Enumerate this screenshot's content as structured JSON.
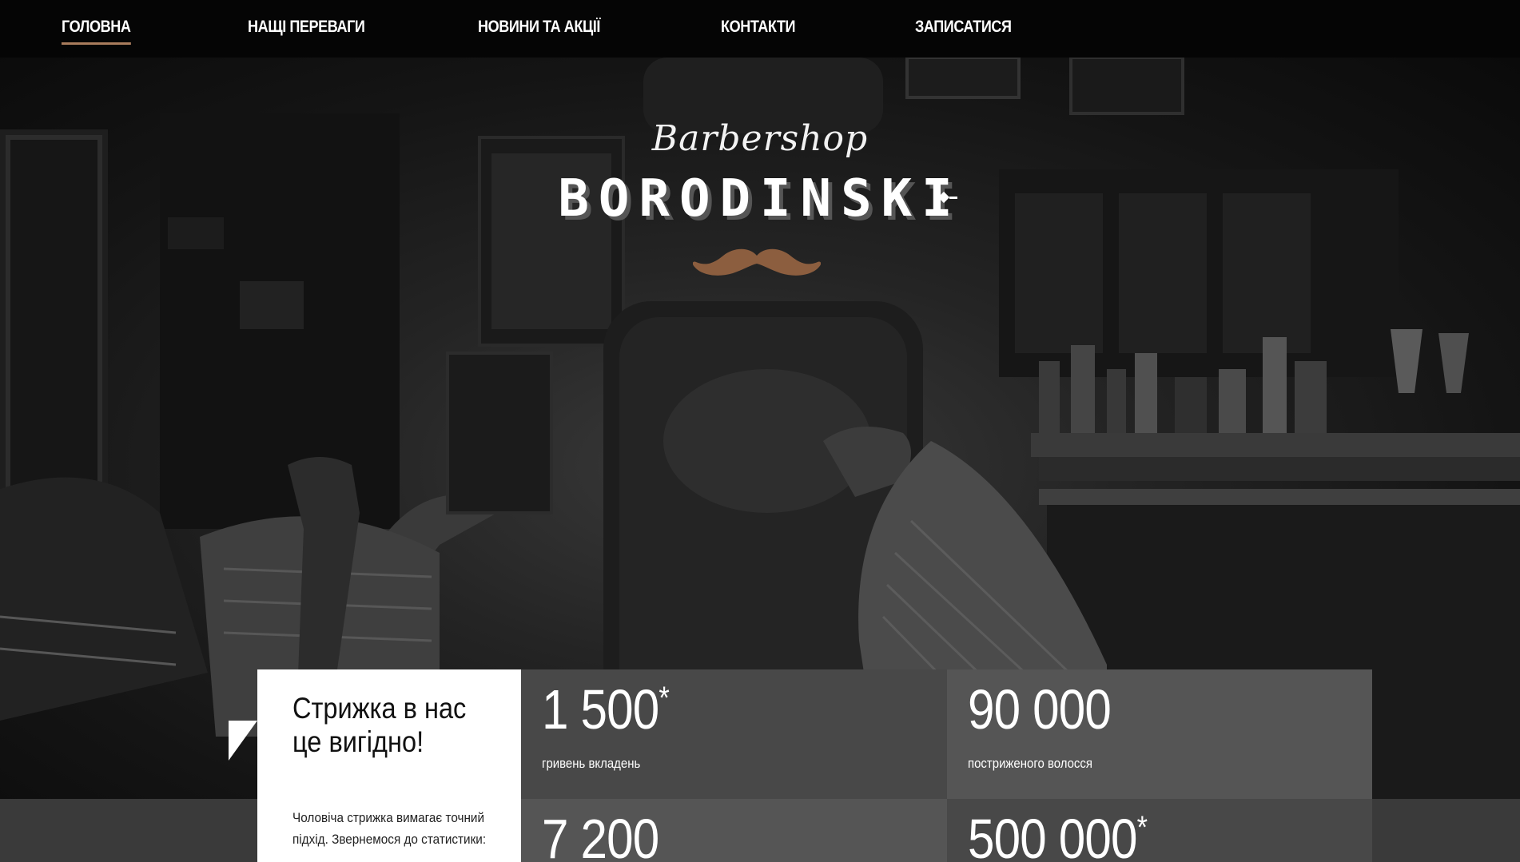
{
  "nav": {
    "items": [
      {
        "label": "ГОЛОВНА",
        "active": true
      },
      {
        "label": "НАЩІ ПЕРЕВАГИ",
        "active": false
      },
      {
        "label": "НОВИНИ ТА АКЦІЇ",
        "active": false
      },
      {
        "label": "КОНТАКТИ",
        "active": false
      },
      {
        "label": "ЗАПИСАТИСЯ",
        "active": false
      }
    ]
  },
  "logo": {
    "script": "Barbershop",
    "title": "BORODINSKI",
    "icon": "mustache-icon"
  },
  "intro": {
    "title": "Стрижка в нас це вигідно!",
    "text": "Чоловіча стрижка вимагає точний підхід. Звернемося до статистики:"
  },
  "stats": [
    {
      "value": "1 500",
      "mark": "*",
      "label": "гривень вкладень"
    },
    {
      "value": "90 000",
      "mark": "",
      "label": "постриженого волосся"
    },
    {
      "value": "7 200",
      "mark": "",
      "label": ""
    },
    {
      "value": "500 000",
      "mark": "*",
      "label": ""
    }
  ],
  "colors": {
    "accent": "#a97c5c",
    "nav_bg": "#050505",
    "stat_dark": "#484848",
    "stat_light": "#555555"
  }
}
